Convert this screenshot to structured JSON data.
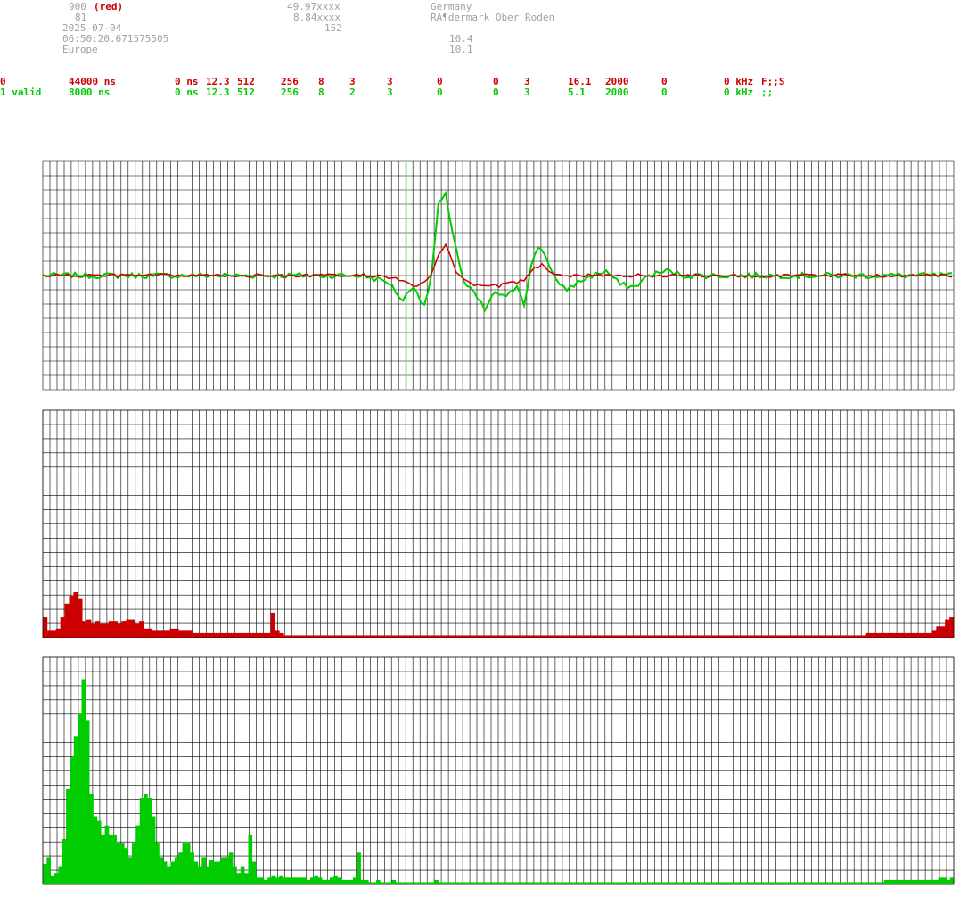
{
  "header": {
    "line1": "900",
    "line1_tag": "(red)",
    "line2": "81",
    "date": "2025-07-04",
    "time": "06:50:20.671575505",
    "region": "Europe",
    "lat": "49.97xxxx",
    "lon": "8.84xxxx",
    "alt": "152",
    "country": "Germany",
    "place": "RÃ¶dermark Ober Roden",
    "v1": "10.4",
    "v2": "10.1"
  },
  "rows": [
    {
      "color": "#cc0000",
      "cells": [
        "0",
        "44000 ns",
        "0 ns",
        "12.3",
        "512",
        "256",
        "8",
        "3",
        "3",
        "0",
        "0",
        "3",
        "16.1",
        "2000",
        "0",
        "0 kHz",
        "F;;S"
      ]
    },
    {
      "color": "#00cc00",
      "cells": [
        "1 valid",
        "8000 ns",
        "0 ns",
        "12.3",
        "512",
        "256",
        "8",
        "2",
        "3",
        "0",
        "0",
        "3",
        "5.1",
        "2000",
        "0",
        "0 kHz",
        ";;"
      ]
    }
  ],
  "colors": {
    "red": "#cc0000",
    "green": "#00cc00",
    "grid": "#000000",
    "marker": "#90ee90",
    "text_gray": "#a0a0a0"
  },
  "chart_data": [
    {
      "type": "line",
      "name": "waveform",
      "x": {
        "range": [
          0,
          511
        ]
      },
      "ylim": [
        -100,
        100
      ],
      "grid": true,
      "marker_x": 204,
      "series": [
        {
          "color": "#00cc00",
          "keypoints": [
            [
              0,
              0
            ],
            [
              180,
              0
            ],
            [
              194,
              -6
            ],
            [
              202,
              -22
            ],
            [
              208,
              -8
            ],
            [
              214,
              -28
            ],
            [
              218,
              0
            ],
            [
              222,
              62
            ],
            [
              226,
              70
            ],
            [
              230,
              38
            ],
            [
              236,
              -6
            ],
            [
              242,
              -16
            ],
            [
              248,
              -30
            ],
            [
              254,
              -14
            ],
            [
              260,
              -20
            ],
            [
              266,
              -8
            ],
            [
              270,
              -24
            ],
            [
              274,
              8
            ],
            [
              278,
              26
            ],
            [
              282,
              18
            ],
            [
              286,
              2
            ],
            [
              290,
              -10
            ],
            [
              294,
              -12
            ],
            [
              300,
              -6
            ],
            [
              308,
              0
            ],
            [
              316,
              4
            ],
            [
              324,
              -8
            ],
            [
              332,
              -10
            ],
            [
              340,
              0
            ],
            [
              350,
              4
            ],
            [
              360,
              0
            ],
            [
              511,
              0
            ]
          ]
        },
        {
          "color": "#cc0000",
          "keypoints": [
            [
              0,
              0
            ],
            [
              190,
              0
            ],
            [
              200,
              -4
            ],
            [
              210,
              -10
            ],
            [
              218,
              0
            ],
            [
              222,
              18
            ],
            [
              226,
              26
            ],
            [
              232,
              4
            ],
            [
              240,
              -8
            ],
            [
              250,
              -10
            ],
            [
              260,
              -8
            ],
            [
              270,
              -4
            ],
            [
              274,
              4
            ],
            [
              280,
              10
            ],
            [
              286,
              2
            ],
            [
              296,
              0
            ],
            [
              511,
              0
            ]
          ]
        }
      ]
    },
    {
      "type": "bar",
      "name": "spectrum-red",
      "color": "#cc0000",
      "ylim": [
        0,
        100
      ],
      "grid": true,
      "values": [
        9,
        3,
        3,
        4,
        9,
        15,
        18,
        20,
        17,
        7,
        8,
        6,
        7,
        6,
        6,
        7,
        7,
        6,
        7,
        8,
        8,
        6,
        7,
        4,
        4,
        3,
        3,
        3,
        3,
        4,
        4,
        3,
        3,
        3,
        2,
        2,
        2,
        2,
        2,
        2,
        2,
        2,
        2,
        2,
        2,
        2,
        2,
        2,
        2,
        2,
        2,
        2,
        11,
        3,
        2,
        1,
        1,
        1,
        1,
        1,
        1,
        1,
        1,
        1,
        1,
        1,
        1,
        1,
        1,
        1,
        1,
        1,
        1,
        1,
        1,
        1,
        1,
        1,
        1,
        1,
        1,
        1,
        1,
        1,
        1,
        1,
        1,
        1,
        1,
        1,
        1,
        1,
        1,
        1,
        1,
        1,
        1,
        1,
        1,
        1,
        1,
        1,
        1,
        1,
        1,
        1,
        1,
        1,
        1,
        1,
        1,
        1,
        1,
        1,
        1,
        1,
        1,
        1,
        1,
        1,
        1,
        1,
        1,
        1,
        1,
        1,
        1,
        1,
        1,
        1,
        1,
        1,
        1,
        1,
        1,
        1,
        1,
        1,
        1,
        1,
        1,
        1,
        1,
        1,
        1,
        1,
        1,
        1,
        1,
        1,
        1,
        1,
        1,
        1,
        1,
        1,
        1,
        1,
        1,
        1,
        1,
        1,
        1,
        1,
        1,
        1,
        1,
        1,
        1,
        1,
        1,
        1,
        1,
        1,
        1,
        1,
        1,
        1,
        1,
        1,
        1,
        1,
        1,
        1,
        1,
        1,
        1,
        1,
        2,
        2,
        2,
        2,
        2,
        2,
        2,
        2,
        2,
        2,
        2,
        2,
        2,
        2,
        2,
        3,
        5,
        5,
        8,
        9
      ]
    },
    {
      "type": "bar",
      "name": "spectrum-green",
      "color": "#00cc00",
      "ylim": [
        0,
        100
      ],
      "grid": true,
      "values": [
        9,
        12,
        4,
        5,
        8,
        20,
        42,
        56,
        65,
        75,
        90,
        72,
        40,
        30,
        28,
        22,
        26,
        22,
        22,
        18,
        18,
        16,
        12,
        18,
        26,
        38,
        40,
        38,
        30,
        18,
        12,
        10,
        8,
        10,
        12,
        14,
        18,
        18,
        14,
        10,
        8,
        12,
        8,
        11,
        10,
        10,
        12,
        12,
        14,
        8,
        5,
        8,
        5,
        22,
        10,
        3,
        3,
        2,
        3,
        4,
        3,
        4,
        3,
        3,
        3,
        3,
        3,
        3,
        2,
        3,
        4,
        3,
        2,
        2,
        3,
        4,
        3,
        2,
        2,
        2,
        3,
        14,
        2,
        2,
        1,
        1,
        2,
        1,
        1,
        1,
        2,
        1,
        1,
        1,
        1,
        1,
        1,
        1,
        1,
        1,
        1,
        2,
        1,
        1,
        1,
        1,
        1,
        1,
        1,
        1,
        1,
        1,
        1,
        1,
        1,
        1,
        1,
        1,
        1,
        1,
        1,
        1,
        1,
        1,
        1,
        1,
        1,
        1,
        1,
        1,
        1,
        1,
        1,
        1,
        1,
        1,
        1,
        1,
        1,
        1,
        1,
        1,
        1,
        1,
        1,
        1,
        1,
        1,
        1,
        1,
        1,
        1,
        1,
        1,
        1,
        1,
        1,
        1,
        1,
        1,
        1,
        1,
        1,
        1,
        1,
        1,
        1,
        1,
        1,
        1,
        1,
        1,
        1,
        1,
        1,
        1,
        1,
        1,
        1,
        1,
        1,
        1,
        1,
        1,
        1,
        1,
        1,
        1,
        1,
        1,
        1,
        1,
        1,
        1,
        1,
        1,
        1,
        1,
        1,
        1,
        1,
        1,
        1,
        1,
        1,
        1,
        1,
        1,
        1,
        1,
        1,
        1,
        1,
        1,
        1,
        1,
        1,
        2,
        2,
        2,
        2,
        2,
        2,
        2,
        2,
        2,
        2,
        2,
        2,
        2,
        2,
        3,
        3,
        2,
        3
      ]
    }
  ]
}
